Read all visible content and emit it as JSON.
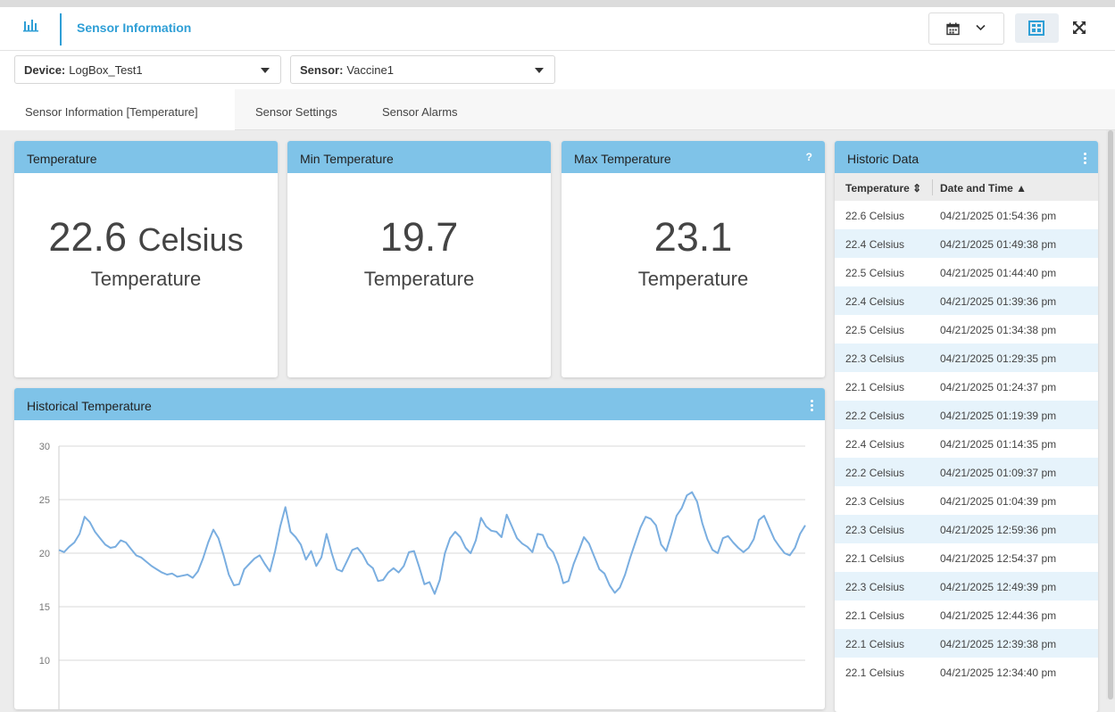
{
  "header": {
    "title": "Sensor Information",
    "icons": {
      "logo": "bar-chart-icon",
      "calendar": "calendar-icon",
      "chevron": "chevron-down-icon",
      "view": "dashboard-view-icon",
      "expand": "expand-icon"
    },
    "accent": "#2f9fd6"
  },
  "selectors": {
    "device_label": "Device:",
    "device_value": "LogBox_Test1",
    "sensor_label": "Sensor:",
    "sensor_value": "Vaccine1"
  },
  "tabs": [
    {
      "label": "Sensor Information [Temperature]",
      "active": true
    },
    {
      "label": "Sensor Settings",
      "active": false
    },
    {
      "label": "Sensor Alarms",
      "active": false
    }
  ],
  "cards": {
    "current": {
      "title": "Temperature",
      "value": "22.6",
      "unit": "Celsius",
      "label": "Temperature"
    },
    "min": {
      "title": "Min Temperature",
      "value": "19.7",
      "label": "Temperature"
    },
    "max": {
      "title": "Max Temperature",
      "value": "23.1",
      "label": "Temperature",
      "help": "?"
    }
  },
  "historic": {
    "title": "Historic Data",
    "col_temp": "Temperature ⇕",
    "col_date": "Date and Time ▲",
    "rows": [
      [
        "22.6 Celsius",
        "04/21/2025 01:54:36 pm"
      ],
      [
        "22.4 Celsius",
        "04/21/2025 01:49:38 pm"
      ],
      [
        "22.5 Celsius",
        "04/21/2025 01:44:40 pm"
      ],
      [
        "22.4 Celsius",
        "04/21/2025 01:39:36 pm"
      ],
      [
        "22.5 Celsius",
        "04/21/2025 01:34:38 pm"
      ],
      [
        "22.3 Celsius",
        "04/21/2025 01:29:35 pm"
      ],
      [
        "22.1 Celsius",
        "04/21/2025 01:24:37 pm"
      ],
      [
        "22.2 Celsius",
        "04/21/2025 01:19:39 pm"
      ],
      [
        "22.4 Celsius",
        "04/21/2025 01:14:35 pm"
      ],
      [
        "22.2 Celsius",
        "04/21/2025 01:09:37 pm"
      ],
      [
        "22.3 Celsius",
        "04/21/2025 01:04:39 pm"
      ],
      [
        "22.3 Celsius",
        "04/21/2025 12:59:36 pm"
      ],
      [
        "22.1 Celsius",
        "04/21/2025 12:54:37 pm"
      ],
      [
        "22.3 Celsius",
        "04/21/2025 12:49:39 pm"
      ],
      [
        "22.1 Celsius",
        "04/21/2025 12:44:36 pm"
      ],
      [
        "22.1 Celsius",
        "04/21/2025 12:39:38 pm"
      ],
      [
        "22.1 Celsius",
        "04/21/2025 12:34:40 pm"
      ]
    ]
  },
  "chart_data": {
    "type": "line",
    "title": "Historical Temperature",
    "ylim": [
      5,
      30
    ],
    "yticks": [
      10,
      15,
      20,
      25,
      30
    ],
    "grid": true,
    "color": "#7aaee0",
    "values": [
      20.3,
      20.1,
      20.6,
      21.0,
      21.8,
      23.4,
      22.9,
      22.0,
      21.4,
      20.8,
      20.5,
      20.6,
      21.2,
      21.0,
      20.4,
      19.8,
      19.6,
      19.2,
      18.8,
      18.5,
      18.2,
      18.0,
      18.1,
      17.8,
      17.9,
      18.0,
      17.7,
      18.3,
      19.5,
      21.0,
      22.2,
      21.4,
      19.8,
      18.0,
      17.0,
      17.1,
      18.5,
      19.0,
      19.5,
      19.8,
      19.0,
      18.3,
      20.2,
      22.5,
      24.3,
      22.0,
      21.5,
      20.8,
      19.4,
      20.2,
      18.8,
      19.6,
      21.8,
      20.0,
      18.5,
      18.3,
      19.3,
      20.3,
      20.5,
      19.9,
      19.0,
      18.6,
      17.4,
      17.5,
      18.2,
      18.6,
      18.2,
      18.8,
      20.1,
      20.2,
      18.7,
      17.1,
      17.3,
      16.2,
      17.5,
      20.0,
      21.4,
      22.0,
      21.5,
      20.5,
      20.0,
      21.2,
      23.3,
      22.5,
      22.1,
      22.0,
      21.5,
      23.6,
      22.5,
      21.4,
      20.9,
      20.6,
      20.1,
      21.8,
      21.7,
      20.6,
      20.1,
      18.9,
      17.2,
      17.4,
      19.0,
      20.2,
      21.5,
      20.9,
      19.7,
      18.5,
      18.1,
      17.0,
      16.3,
      16.8,
      18.0,
      19.6,
      21.0,
      22.4,
      23.4,
      23.2,
      22.6,
      20.8,
      20.2,
      21.8,
      23.5,
      24.2,
      25.4,
      25.7,
      24.8,
      22.8,
      21.3,
      20.3,
      20.0,
      21.4,
      21.6,
      21.0,
      20.5,
      20.1,
      20.5,
      21.3,
      23.1,
      23.5,
      22.4,
      21.3,
      20.6,
      20.0,
      19.8,
      20.5,
      21.8,
      22.6
    ]
  }
}
